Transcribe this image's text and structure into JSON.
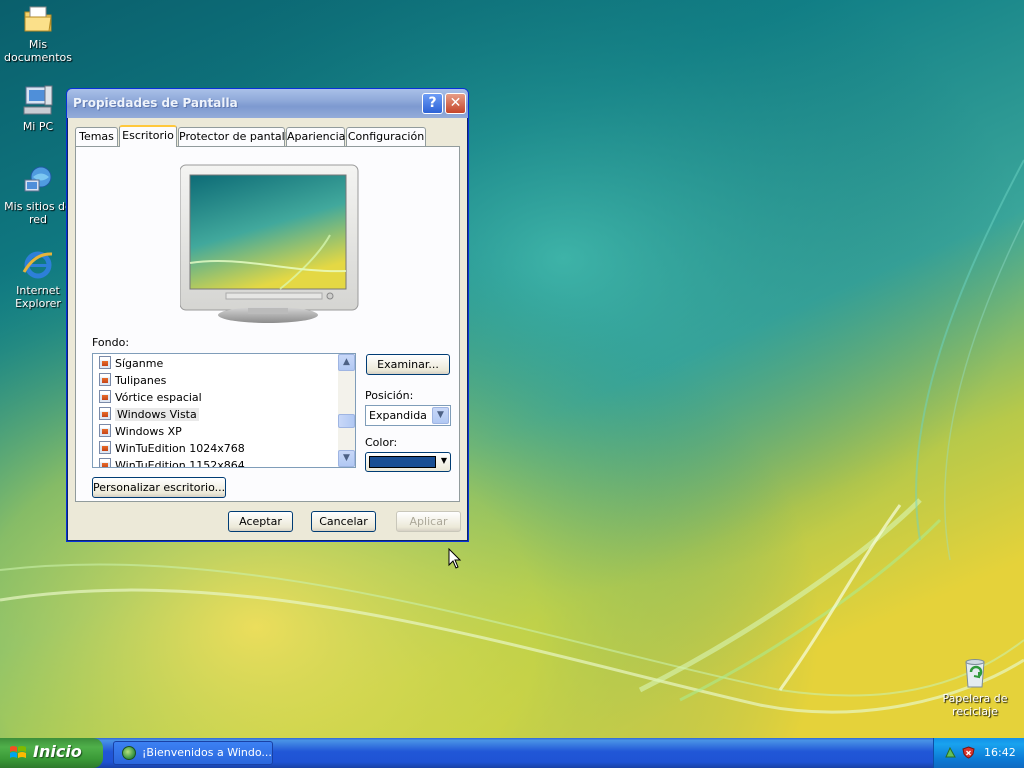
{
  "desktop": {
    "icons": [
      {
        "label": "Mis documentos"
      },
      {
        "label": "Mi PC"
      },
      {
        "label": "Mis sitios de red"
      },
      {
        "label": "Internet Explorer"
      },
      {
        "label": "Papelera de reciclaje"
      }
    ]
  },
  "window": {
    "title": "Propiedades de Pantalla",
    "help_glyph": "?",
    "close_glyph": "✕",
    "tabs": [
      {
        "label": "Temas"
      },
      {
        "label": "Escritorio"
      },
      {
        "label": "Protector de pantalla"
      },
      {
        "label": "Apariencia"
      },
      {
        "label": "Configuración"
      }
    ],
    "active_tab": "Escritorio",
    "fondo_label": "Fondo:",
    "background_list": [
      {
        "label": "Síganme"
      },
      {
        "label": "Tulipanes"
      },
      {
        "label": "Vórtice espacial"
      },
      {
        "label": "Windows Vista"
      },
      {
        "label": "Windows XP"
      },
      {
        "label": "WinTuEdition 1024x768"
      },
      {
        "label": "WinTuEdition 1152x864"
      }
    ],
    "selected_background": "Windows Vista",
    "browse_button": "Examinar...",
    "position_label": "Posición:",
    "position_value": "Expandida",
    "color_label": "Color:",
    "color_value": "#1a4f94",
    "customize_button": "Personalizar escritorio...",
    "ok_button": "Aceptar",
    "cancel_button": "Cancelar",
    "apply_button": "Aplicar"
  },
  "taskbar": {
    "start_label": "Inicio",
    "task_label": "¡Bienvenidos a Windo...",
    "clock": "16:42"
  },
  "colors": {
    "titlebar": "#8fa9d9",
    "taskbar": "#2157d7",
    "start": "#3a9a37",
    "tab_highlight": "#ffc83c"
  }
}
